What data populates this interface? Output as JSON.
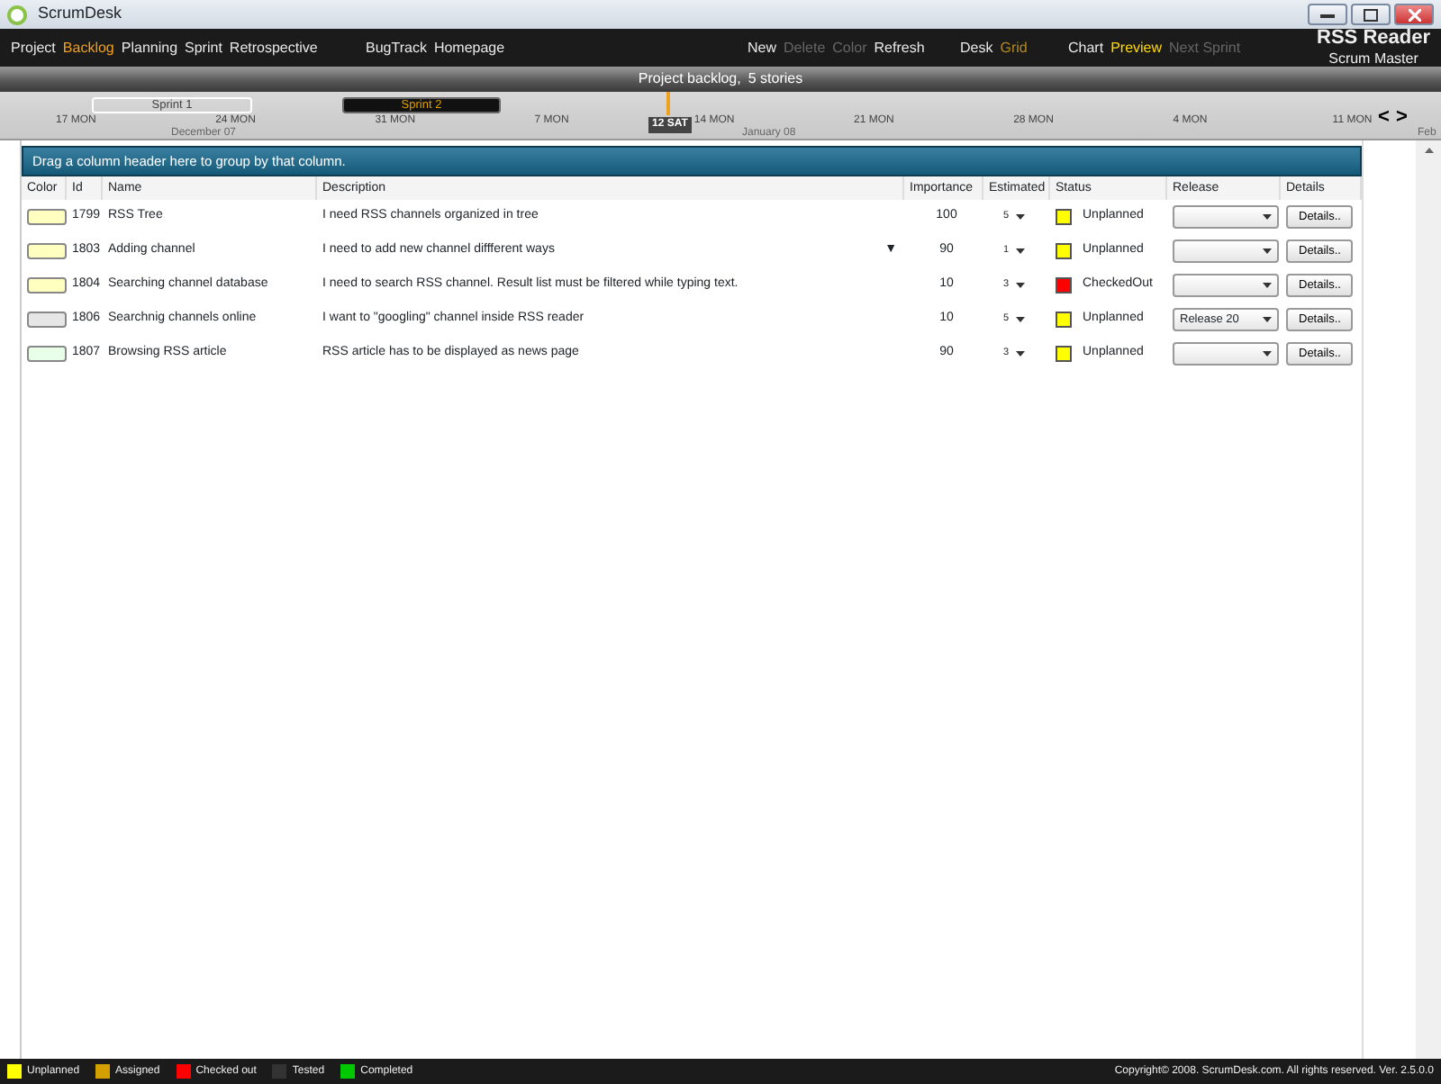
{
  "window": {
    "title": "ScrumDesk"
  },
  "nav": [
    {
      "label": "Project",
      "selected": false
    },
    {
      "label": "Backlog",
      "selected": true
    },
    {
      "label": "Planning",
      "selected": false
    },
    {
      "label": "Sprint",
      "selected": false
    },
    {
      "label": "Retrospective",
      "selected": false
    }
  ],
  "links": [
    {
      "label": "BugTrack"
    },
    {
      "label": "Homepage"
    }
  ],
  "actions": [
    {
      "label": "New",
      "disabled": false
    },
    {
      "label": "Delete",
      "disabled": true
    },
    {
      "label": "Color",
      "disabled": true
    },
    {
      "label": "Refresh",
      "disabled": false
    }
  ],
  "views": [
    {
      "label": "Desk",
      "selected": false
    },
    {
      "label": "Grid",
      "selected": true
    }
  ],
  "panels": [
    {
      "label": "Chart",
      "selected": false,
      "disabled": false
    },
    {
      "label": "Preview",
      "selected": true,
      "disabled": false
    },
    {
      "label": "Next Sprint",
      "selected": false,
      "disabled": true
    }
  ],
  "project": {
    "name": "RSS Reader",
    "role": "Scrum Master"
  },
  "backlog_bar": {
    "title": "Project backlog,",
    "count": "5 stories"
  },
  "timeline": {
    "sprints": [
      {
        "label": "Sprint 1",
        "selected": false
      },
      {
        "label": "Sprint 2",
        "selected": true
      }
    ],
    "dates": [
      "17 MON",
      "24 MON",
      "31 MON",
      "7 MON",
      "14 MON",
      "21 MON",
      "28 MON",
      "4 MON",
      "11 MON"
    ],
    "months": [
      "December 07",
      "January 08",
      "Feb"
    ],
    "today": "12 SAT",
    "prev": "<",
    "next": ">"
  },
  "group_hint": "Drag a column header here to group by that column.",
  "table": {
    "columns": [
      "Color",
      "Id",
      "Name",
      "Description",
      "Importance",
      "Estimated",
      "Status",
      "Release",
      "Details"
    ],
    "rows": [
      {
        "color": "#ffffc0",
        "id": "1799",
        "name": "RSS Tree",
        "description": "I need RSS channels organized in tree",
        "importance": "100",
        "estimated": "5",
        "status": {
          "label": "Unplanned",
          "color": "#ffff00"
        },
        "details": "Details.."
      },
      {
        "color": "#ffffc0",
        "id": "1803",
        "name": "Adding channel",
        "description": "I need to add new channel diffferent ways",
        "marker": "▼",
        "importance": "90",
        "estimated": "1",
        "status": {
          "label": "Unplanned",
          "color": "#ffff00"
        },
        "details": "Details.."
      },
      {
        "color": "#ffffc0",
        "id": "1804",
        "name": "Searching channel database",
        "description": "I need to search RSS channel. Result list must be filtered while typing text.",
        "importance": "10",
        "estimated": "3",
        "status": {
          "label": "CheckedOut",
          "color": "#ff0000"
        },
        "details": "Details.."
      },
      {
        "color": "#e6e6e6",
        "id": "1806",
        "name": "Searchnig channels online",
        "description": "I want to \"googling\" channel inside RSS reader",
        "importance": "10",
        "estimated": "5",
        "status": {
          "label": "Unplanned",
          "color": "#ffff00"
        },
        "release": "Release 20",
        "details": "Details.."
      },
      {
        "color": "#e8ffe8",
        "id": "1807",
        "name": "Browsing RSS article",
        "description": "RSS article has to be displayed as news page",
        "importance": "90",
        "estimated": "3",
        "status": {
          "label": "Unplanned",
          "color": "#ffff00"
        },
        "details": "Details.."
      }
    ]
  },
  "legend": [
    {
      "label": "Unplanned",
      "color": "#ffff00"
    },
    {
      "label": "Assigned",
      "color": "#d4a000"
    },
    {
      "label": "Checked out",
      "color": "#ff0000"
    },
    {
      "label": "Tested",
      "color": "#333333"
    },
    {
      "label": "Completed",
      "color": "#00c800"
    }
  ],
  "copyright": "Copyright© 2008. ScrumDesk.com. All rights reserved. Ver. 2.5.0.0"
}
